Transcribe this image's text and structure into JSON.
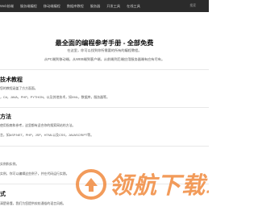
{
  "nav": {
    "items": [
      "Web前端",
      "服务端编程",
      "移动端编程",
      "数据库教程",
      "服务器",
      "开发工具",
      "在线工具"
    ],
    "search_label": "搜索"
  },
  "hero": {
    "title": "最全面的编程参考手册 - 全部免费",
    "subtitle": "在这里，你可以找到你所需要的所有的编程教程。",
    "description": "从PC端到移动端，从WEB端到客户端，从前端到后端应用服务器端有应有尽有。"
  },
  "sections": [
    {
      "title": "技术教程",
      "lines": [
        "您的教程涵盖了方方面面。",
        "，C#，JAVA，PHP，PYTHON，以及其他技术，如XML，数据库，服务器等。"
      ]
    },
    {
      "title": "方法",
      "lines": [
        "使用指南和参考，这里都有适合你的搜索网站的方法。",
        "言，如ASP.NET，PHP，JSP，HTML以及CSS，JAVASCRIPT等。"
      ]
    },
    {
      "title": "",
      "lines": [
        "实例和实例。",
        "实例，你可以编辑这些例子，并在代码运行实践。"
      ]
    },
    {
      "title": "式",
      "lines": [
        "清楚易懂，我们为您提供较较通俗的语言风格，"
      ]
    }
  ],
  "watermark": {
    "text": "领航下载站"
  },
  "colors": {
    "nav_bg": "#2b2b2b",
    "watermark": "#f08a3e"
  }
}
